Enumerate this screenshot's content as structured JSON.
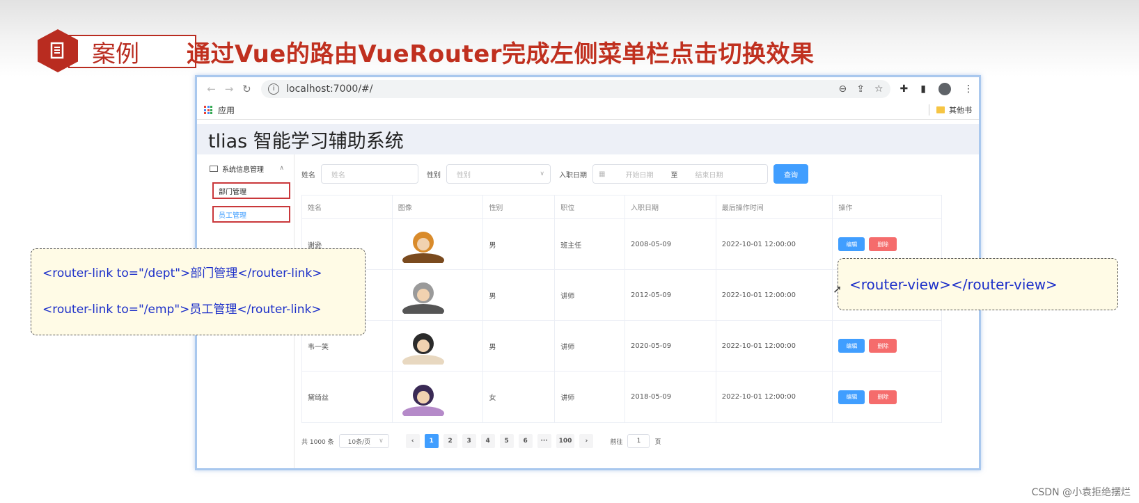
{
  "slide": {
    "badge_label": "案例",
    "title": "通过Vue的路由VueRouter完成左侧菜单栏点击切换效果",
    "watermark": "CSDN @小袁拒绝摆烂"
  },
  "browser": {
    "url": "localhost:7000/#/",
    "bookmark_apps": "应用",
    "bookmark_other": "其他书"
  },
  "app": {
    "title": "tlias 智能学习辅助系统",
    "menu_group": "系统信息管理",
    "menu_items": [
      "部门管理",
      "员工管理"
    ]
  },
  "filters": {
    "name_label": "姓名",
    "name_placeholder": "姓名",
    "gender_label": "性别",
    "gender_placeholder": "性别",
    "date_label": "入职日期",
    "date_start": "开始日期",
    "date_sep": "至",
    "date_end": "结束日期",
    "query_button": "查询"
  },
  "table": {
    "headers": [
      "姓名",
      "图像",
      "性别",
      "职位",
      "入职日期",
      "最后操作时间",
      "操作"
    ],
    "rows": [
      {
        "name": "谢逊",
        "gender": "男",
        "position": "班主任",
        "entry": "2008-05-09",
        "updated": "2022-10-01 12:00:00"
      },
      {
        "name": "",
        "gender": "男",
        "position": "讲师",
        "entry": "2012-05-09",
        "updated": "2022-10-01 12:00:00"
      },
      {
        "name": "韦一笑",
        "gender": "男",
        "position": "讲师",
        "entry": "2020-05-09",
        "updated": "2022-10-01 12:00:00"
      },
      {
        "name": "黛绮丝",
        "gender": "女",
        "position": "讲师",
        "entry": "2018-05-09",
        "updated": "2022-10-01 12:00:00"
      }
    ],
    "edit_label": "编辑",
    "delete_label": "删除"
  },
  "pager": {
    "total": "共 1000 条",
    "page_size": "10条/页",
    "pages": [
      "1",
      "2",
      "3",
      "4",
      "5",
      "6",
      "···",
      "100"
    ],
    "goto_label": "前往",
    "goto_value": "1",
    "page_suffix": "页"
  },
  "callouts": {
    "router_link_dept": "<router-link to=\"/dept\">部门管理</router-link>",
    "router_link_emp": "<router-link to=\"/emp\">员工管理</router-link>",
    "router_view": "<router-view></router-view>"
  },
  "colors": {
    "accent_red": "#b92c20",
    "primary_blue": "#409eff",
    "danger": "#f56c6c",
    "callout_text": "#1c2fc9",
    "callout_bg": "#fffbe6"
  }
}
